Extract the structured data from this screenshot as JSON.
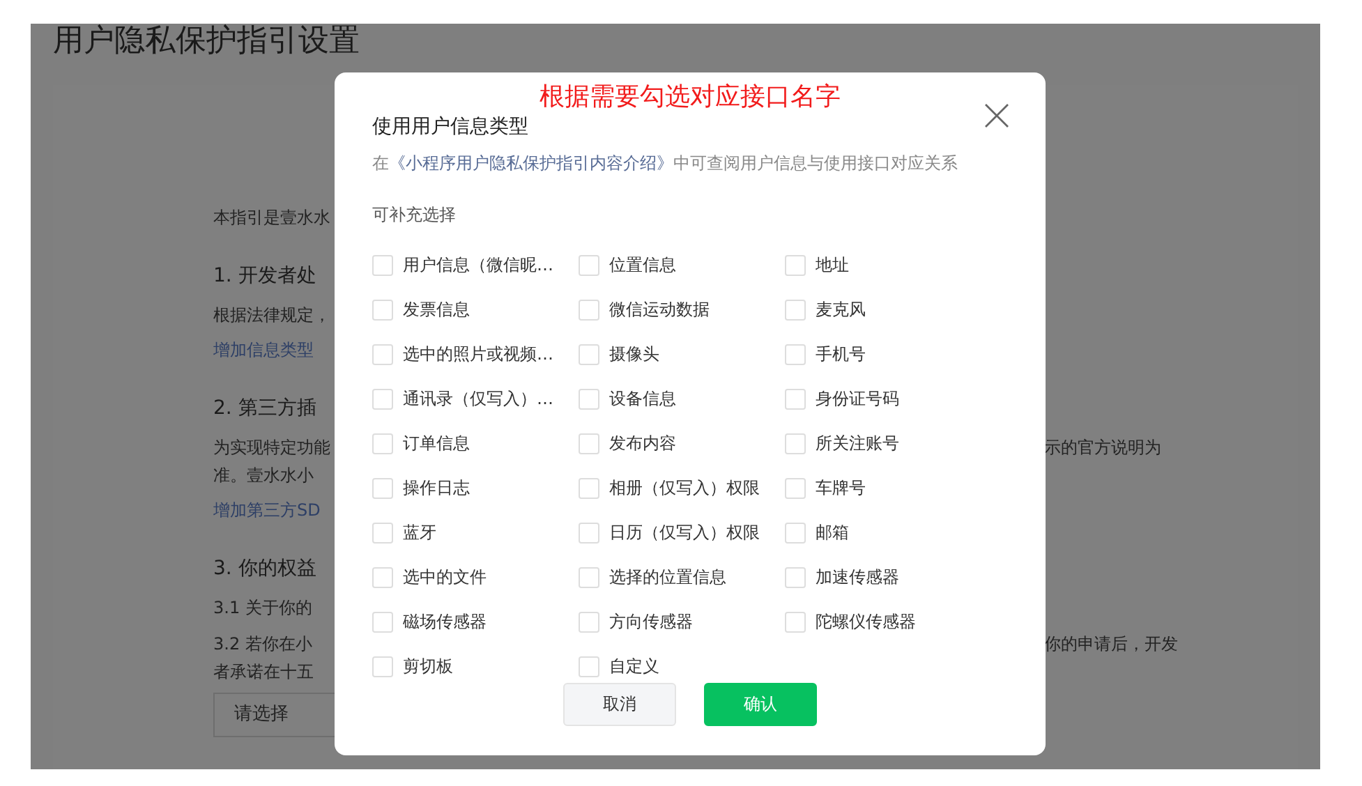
{
  "page": {
    "title": "用户隐私保护指引设置",
    "content": [
      {
        "kind": "text",
        "text": "本指引是壹水水"
      },
      {
        "kind": "heading",
        "text": "1. 开发者处"
      },
      {
        "kind": "text",
        "text": "根据法律规定，"
      },
      {
        "kind": "link",
        "text": "增加信息类型"
      },
      {
        "kind": "heading",
        "text": "2. 第三方插"
      },
      {
        "kind": "text",
        "text": "为实现特定功能",
        "text_right": "示的官方说明为"
      },
      {
        "kind": "line",
        "text": "准。壹水水小"
      },
      {
        "kind": "link",
        "text": "增加第三方SD"
      },
      {
        "kind": "heading",
        "text": "3. 你的权益"
      },
      {
        "kind": "text",
        "text": "3.1  关于你的"
      },
      {
        "kind": "text",
        "text": "3.2  若你在小",
        "text_right": "你的申请后，开发"
      },
      {
        "kind": "line",
        "text": "者承诺在十五"
      },
      {
        "kind": "select",
        "placeholder": "请选择"
      }
    ]
  },
  "annotation": "根据需要勾选对应接口名字",
  "dialog": {
    "title": "使用用户信息类型",
    "subtitle_before": "在",
    "subtitle_link": "《小程序用户隐私保护指引内容介绍》",
    "subtitle_after": "中可查阅用户信息与使用接口对应关系",
    "section": "可补充选择",
    "options": [
      {
        "label": "用户信息（微信昵…",
        "checked": false
      },
      {
        "label": "位置信息",
        "checked": false
      },
      {
        "label": "地址",
        "checked": false
      },
      {
        "label": "发票信息",
        "checked": false
      },
      {
        "label": "微信运动数据",
        "checked": false
      },
      {
        "label": "麦克风",
        "checked": false
      },
      {
        "label": "选中的照片或视频…",
        "checked": false
      },
      {
        "label": "摄像头",
        "checked": false
      },
      {
        "label": "手机号",
        "checked": false
      },
      {
        "label": "通讯录（仅写入）…",
        "checked": false
      },
      {
        "label": "设备信息",
        "checked": false
      },
      {
        "label": "身份证号码",
        "checked": false
      },
      {
        "label": "订单信息",
        "checked": false
      },
      {
        "label": "发布内容",
        "checked": false
      },
      {
        "label": "所关注账号",
        "checked": false
      },
      {
        "label": "操作日志",
        "checked": false
      },
      {
        "label": "相册（仅写入）权限",
        "checked": false
      },
      {
        "label": "车牌号",
        "checked": false
      },
      {
        "label": "蓝牙",
        "checked": false
      },
      {
        "label": "日历（仅写入）权限",
        "checked": false
      },
      {
        "label": "邮箱",
        "checked": false
      },
      {
        "label": "选中的文件",
        "checked": false
      },
      {
        "label": "选择的位置信息",
        "checked": false
      },
      {
        "label": "加速传感器",
        "checked": false
      },
      {
        "label": "磁场传感器",
        "checked": false
      },
      {
        "label": "方向传感器",
        "checked": false
      },
      {
        "label": "陀螺仪传感器",
        "checked": false
      },
      {
        "label": "剪切板",
        "checked": false
      },
      {
        "label": "自定义",
        "checked": false
      }
    ],
    "buttons": [
      {
        "kind": "secondary",
        "label": "取消"
      },
      {
        "kind": "primary",
        "label": "确认"
      }
    ]
  }
}
